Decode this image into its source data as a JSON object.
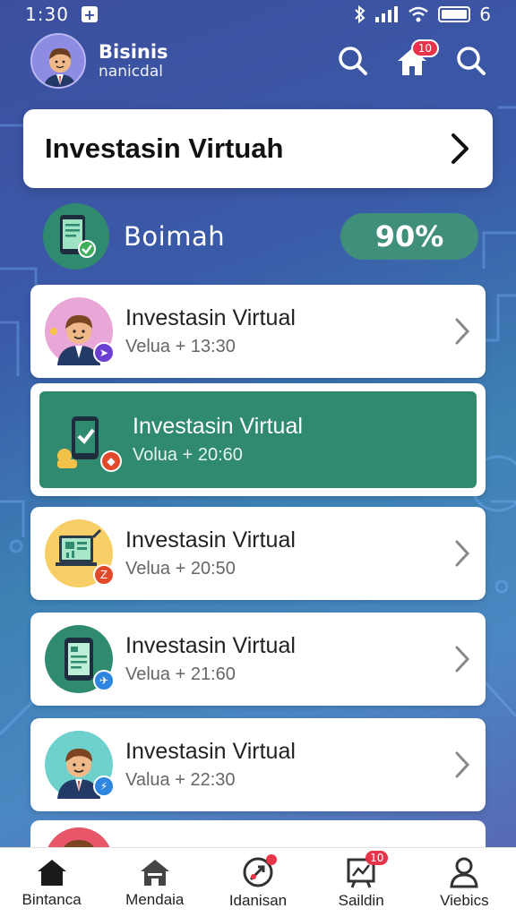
{
  "status_bar": {
    "time": "1:30",
    "plus": "+",
    "battery_label": "6"
  },
  "header": {
    "name": "Bisinis",
    "subtitle": "nanicdal",
    "notification_count": "10"
  },
  "title_card": {
    "title": "Investasin Virtuah"
  },
  "summary": {
    "label": "Boimah",
    "percent": "90%"
  },
  "items": [
    {
      "title": "Investasin Virtual",
      "subtitle": "Velua + 13:30",
      "avatar": "person-avatar",
      "avatar_bg": "#e9a7d8",
      "badge_color": "#6b3fd1"
    },
    {
      "title": "Investasin Virtual",
      "subtitle": "Volua + 20:60",
      "avatar": "phone-check-icon",
      "avatar_bg": "#2f8a6f",
      "badge_color": "#e0492a",
      "selected": true
    },
    {
      "title": "Investasin Virtual",
      "subtitle": "Velua + 20:50",
      "avatar": "laptop-chart-icon",
      "avatar_bg": "#f7cf66",
      "badge_color": "#e0492a"
    },
    {
      "title": "Investasin Virtual",
      "subtitle": "Velua + 21:60",
      "avatar": "phone-doc-icon",
      "avatar_bg": "#2f8a6f",
      "badge_color": "#2f86e0"
    },
    {
      "title": "Investasin Virtual",
      "subtitle": "Valua + 22:30",
      "avatar": "person-avatar",
      "avatar_bg": "#6fd1cc",
      "badge_color": "#2f86e0"
    }
  ],
  "bottom_nav": [
    {
      "label": "Bintanca",
      "icon": "home-icon"
    },
    {
      "label": "Mendaia",
      "icon": "home-outline-icon"
    },
    {
      "label": "Idanisan",
      "icon": "rocket-icon",
      "dot": true
    },
    {
      "label": "Saildin",
      "icon": "chart-board-icon",
      "badge": "10"
    },
    {
      "label": "Viebics",
      "icon": "profile-icon"
    }
  ]
}
